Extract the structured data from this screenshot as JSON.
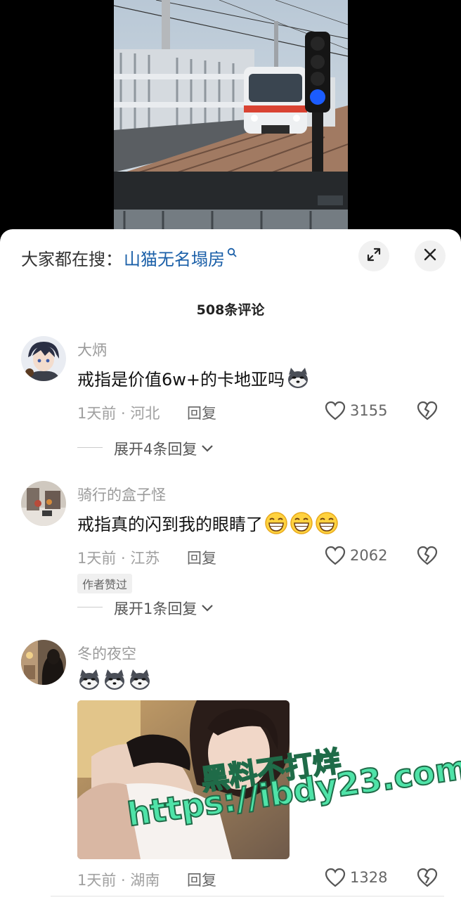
{
  "search": {
    "prefix": "大家都在搜：",
    "term": "山猫无名塌房",
    "icon": "search-icon"
  },
  "comment_count": "508条评论",
  "comments": [
    {
      "username": "大炳",
      "text": "戒指是价值6w+的卡地亚吗",
      "emoji": [
        "husky-emoji"
      ],
      "meta": "1天前 · 河北",
      "reply_label": "回复",
      "likes": "3155",
      "expand_label": "展开4条回复"
    },
    {
      "username": "骑行的盒子怪",
      "text": "戒指真的闪到我的眼睛了",
      "emoji": [
        "grin-emoji",
        "grin-emoji",
        "grin-emoji"
      ],
      "meta": "1天前 · 江苏",
      "reply_label": "回复",
      "likes": "2062",
      "badge": "作者赞过",
      "expand_label": "展开1条回复"
    },
    {
      "username": "冬的夜空",
      "text": "",
      "emoji": [
        "husky-emoji",
        "husky-emoji",
        "husky-emoji"
      ],
      "meta": "1天前 · 湖南",
      "reply_label": "回复",
      "likes": "1328"
    }
  ],
  "watermark": {
    "line1": "黑料不打烊",
    "line2": "https://ibdy23.com"
  },
  "colors": {
    "search_term": "#1a5fa8",
    "watermark_fill": "#4fe3a8",
    "signal_light": "#1b5cff"
  }
}
